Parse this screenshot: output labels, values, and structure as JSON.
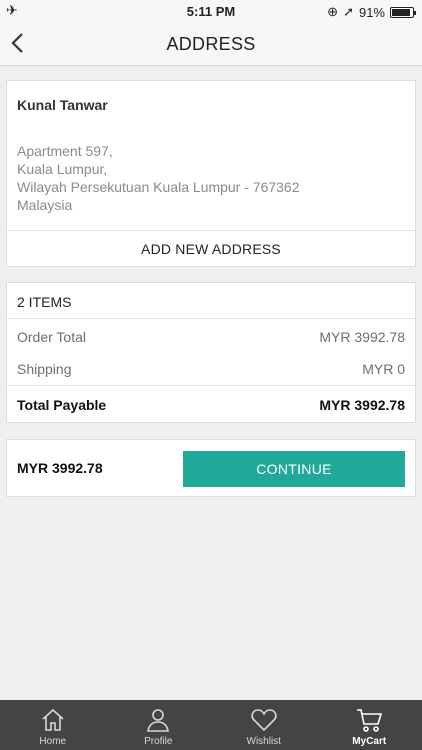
{
  "status_bar": {
    "time": "5:11 PM",
    "battery": "91%",
    "battery_level": 0.91
  },
  "header": {
    "title": "ADDRESS"
  },
  "address": {
    "name": "Kunal Tanwar",
    "lines": [
      "Apartment 597,",
      "Kuala Lumpur,",
      "Wilayah Persekutuan Kuala Lumpur - 767362",
      "Malaysia"
    ],
    "add_new_label": "ADD NEW ADDRESS"
  },
  "summary": {
    "items_label": "2 ITEMS",
    "rows": [
      {
        "label": "Order Total",
        "value": "MYR 3992.78"
      },
      {
        "label": "Shipping",
        "value": "MYR 0"
      }
    ],
    "total": {
      "label": "Total Payable",
      "value": "MYR 3992.78"
    }
  },
  "checkout": {
    "amount": "MYR 3992.78",
    "button_label": "CONTINUE"
  },
  "tabbar": {
    "tabs": [
      {
        "label": "Home",
        "icon": "home-icon"
      },
      {
        "label": "Profile",
        "icon": "profile-icon"
      },
      {
        "label": "Wishlist",
        "icon": "heart-icon"
      },
      {
        "label": "MyCart",
        "icon": "cart-icon",
        "active": true
      }
    ]
  }
}
